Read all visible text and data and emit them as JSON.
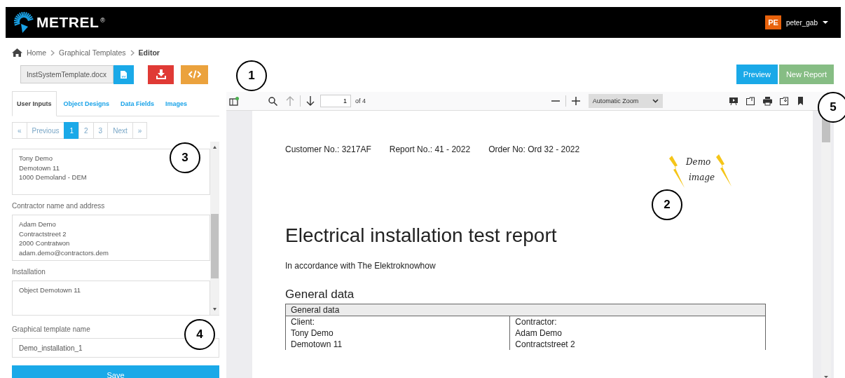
{
  "header": {
    "brand": "METREL",
    "registered": "®",
    "user": {
      "initials": "PE",
      "name": "peter_gab"
    }
  },
  "breadcrumb": [
    {
      "label": "Home",
      "current": false
    },
    {
      "label": "Graphical Templates",
      "current": false
    },
    {
      "label": "Editor",
      "current": true
    }
  ],
  "file": {
    "value": "InstSystemTemplate.docx"
  },
  "tabs": [
    {
      "label": "User Inputs",
      "selected": true
    },
    {
      "label": "Object Designs",
      "selected": false
    },
    {
      "label": "Data Fields",
      "selected": false
    },
    {
      "label": "Images",
      "selected": false
    }
  ],
  "pagination": [
    {
      "label": "«",
      "selected": false
    },
    {
      "label": "Previous",
      "selected": false
    },
    {
      "label": "1",
      "selected": true
    },
    {
      "label": "2",
      "selected": false
    },
    {
      "label": "3",
      "selected": false
    },
    {
      "label": "Next",
      "selected": false
    },
    {
      "label": "»",
      "selected": false
    }
  ],
  "fields": [
    {
      "value": "Tony Demo\nDemotown 11\n1000 Demoland - DEM"
    },
    {
      "label": "Contractor name and address",
      "value": "Adam Demo\nContractstreet 2\n2000 Contratwon\nadam.demo@contractors.dem"
    },
    {
      "label": "Installation",
      "value": "Object Demotown 11"
    }
  ],
  "template_name": {
    "label": "Graphical template name",
    "value": "Demo_installation_1"
  },
  "save_button": "Save",
  "actions": [
    {
      "label": "Preview",
      "kind": "primary"
    },
    {
      "label": "New Report",
      "kind": "success"
    }
  ],
  "viewer": {
    "page_number": "1",
    "page_count": "of 4",
    "zoom": "Automatic Zoom",
    "document": {
      "header": [
        "Customer No.: 3217AF",
        "Report No.: 41 - 2022",
        "Order No: Ord 32 - 2022"
      ],
      "image_text": [
        "Demo",
        "image"
      ],
      "title": "Electrical installation test report",
      "subtitle": "In accordance with The Elektroknowhow",
      "section": "General data",
      "table": {
        "heading": "General data",
        "rows": [
          [
            "Client:",
            "Contractor:"
          ],
          [
            "Tony Demo",
            "Adam Demo"
          ],
          [
            "Demotown 11",
            "Contractstreet 2"
          ]
        ]
      }
    }
  },
  "callouts": [
    "1",
    "2",
    "3",
    "4",
    "5"
  ]
}
